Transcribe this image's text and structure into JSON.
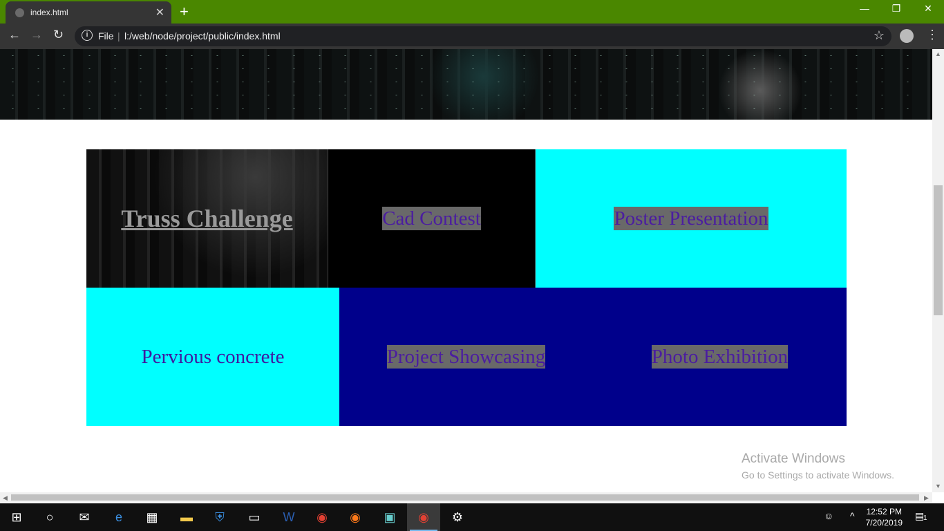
{
  "browser": {
    "tab_title": "index.html",
    "new_tab": "+",
    "close_tab": "✕",
    "omnibox_scheme": "File",
    "url": "l:/web/node/project/public/index.html",
    "window_controls": {
      "minimize": "—",
      "restore": "❐",
      "close": "✕"
    }
  },
  "events": {
    "truss": "Truss Challenge",
    "cad": "Cad Contest",
    "poster": "Poster Presentation",
    "pervious": "Pervious concrete",
    "project": "Project Showcasing",
    "photo": "Photo Exhibition"
  },
  "watermark": {
    "line1": "Activate Windows",
    "line2": "Go to Settings to activate Windows."
  },
  "taskbar": {
    "time": "12:52 PM",
    "date": "7/20/2019",
    "notification_count": "1",
    "icons": [
      "windows-start-icon",
      "cortana-icon",
      "mail-icon",
      "edge-icon",
      "store-icon",
      "file-explorer-icon",
      "defender-icon",
      "cmd-icon",
      "word-icon",
      "chrome-icon",
      "firefox-icon",
      "app-icon",
      "chrome-icon",
      "settings-icon"
    ]
  },
  "colors": {
    "tab_strip": "#4a8700",
    "cyan": "#00ffff",
    "dark_blue": "#00008b",
    "text_purple": "#4b1da0",
    "highlight_gray": "#696969"
  }
}
